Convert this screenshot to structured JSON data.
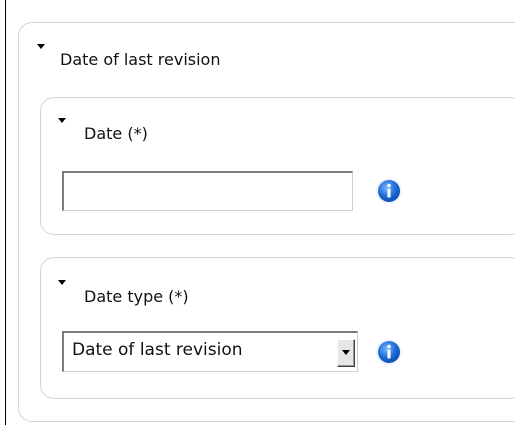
{
  "section": {
    "title": "Date of last revision"
  },
  "date_field": {
    "label": "Date (*)",
    "value": "",
    "info_icon": "info-icon"
  },
  "date_type_field": {
    "label": "Date type (*)",
    "selected": "Date of last revision",
    "info_icon": "info-icon"
  },
  "colors": {
    "info_blue": "#1e6fd9",
    "panel_border": "#d4d4d4"
  }
}
